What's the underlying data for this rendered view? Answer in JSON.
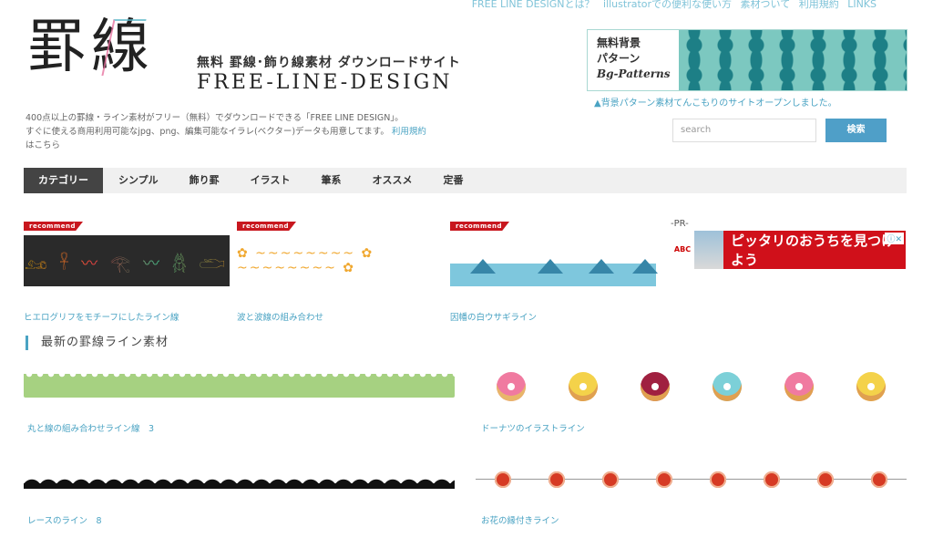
{
  "top_nav": [
    "FREE LINE DESIGNとは？",
    "illustratorでの便利な使い方",
    "素材ついて",
    "利用規約",
    "LINKS"
  ],
  "logo": {
    "kanji1": "罫",
    "kanji2": "線",
    "tagline": "無料 罫線･飾り線素材 ダウンロードサイト",
    "brand": "FREE-LINE-DESIGN"
  },
  "intro": {
    "text1": "400点以上の罫線・ライン素材がフリー（無料）でダウンロードできる「FREE LINE DESIGN」。",
    "text2": "すぐに使える商用利用可能なjpg、png、編集可能なイラレ(ベクター)データも用意してます。",
    "link": "利用規約",
    "text3": "はこちら"
  },
  "bg_banner": {
    "line1": "無料背景",
    "line2": "パターン",
    "line3": "Bg-Patterns",
    "note": "▲背景パターン素材てんこもりのサイトオープンしました。"
  },
  "search": {
    "placeholder": "search",
    "button": "検索"
  },
  "categories": [
    "カテゴリー",
    "シンプル",
    "飾り罫",
    "イラスト",
    "筆系",
    "オススメ",
    "定番"
  ],
  "recommend": {
    "badge": "recommend",
    "items": [
      {
        "caption": "ヒエログリフをモチーフにしたライン線",
        "glyphs": "𓃭 𓋹 〰 𓂀 〰 𓆣 𓂧"
      },
      {
        "caption": "波と波線の組み合わせ",
        "glyphs": "✿ ~~~~~~~~ ✿ ~~~~~~~~ ✿"
      },
      {
        "caption": "因幡の白ウサギライン"
      }
    ]
  },
  "pr": {
    "label": "-PR-",
    "abc": "ABC",
    "copy": "ピッタリのおうちを見つけよう",
    "close": "ⓘ✕"
  },
  "section_title": "最新の罫線ライン素材",
  "latest": [
    {
      "caption": "丸と線の組み合わせライン線　3"
    },
    {
      "caption": "ドーナツのイラストライン"
    },
    {
      "caption": "レースのライン　8"
    },
    {
      "caption": "お花の縁付きライン"
    }
  ],
  "colors": {
    "accent": "#4aa3c3",
    "badge": "#c8171e",
    "ad": "#d0101a",
    "active_tab": "#444444"
  }
}
